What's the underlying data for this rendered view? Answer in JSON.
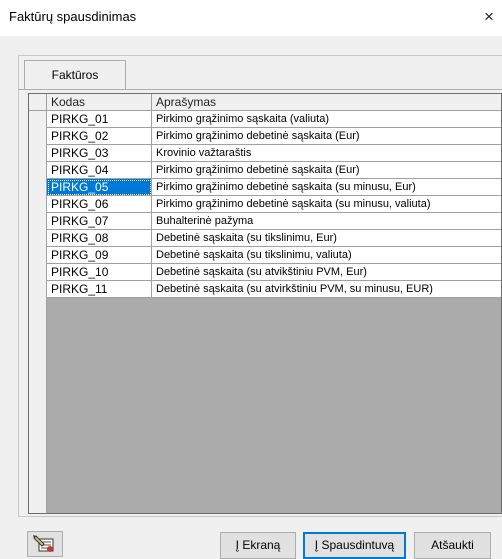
{
  "window": {
    "title": "Faktūrų spausdinimas",
    "close_label": "×"
  },
  "tabs": [
    {
      "label": "Faktūros"
    }
  ],
  "grid": {
    "columns": [
      "Kodas",
      "Aprašymas"
    ],
    "selected_index": 4,
    "rows": [
      {
        "code": "PIRKG_01",
        "description": "Pirkimo grąžinimo sąskaita (valiuta)"
      },
      {
        "code": "PIRKG_02",
        "description": "Pirkimo grąžinimo debetinė sąskaita (Eur)"
      },
      {
        "code": "PIRKG_03",
        "description": "Krovinio važtaraštis"
      },
      {
        "code": "PIRKG_04",
        "description": "Pirkimo grąžinimo debetinė sąskaita (Eur)"
      },
      {
        "code": "PIRKG_05",
        "description": "Pirkimo grąžinimo debetinė sąskaita (su minusu, Eur)"
      },
      {
        "code": "PIRKG_06",
        "description": "Pirkimo grąžinimo debetinė sąskaita (su minusu, valiuta)"
      },
      {
        "code": "PIRKG_07",
        "description": "Buhalterinė pažyma"
      },
      {
        "code": "PIRKG_08",
        "description": "Debetinė sąskaita (su tikslinimu, Eur)"
      },
      {
        "code": "PIRKG_09",
        "description": "Debetinė sąskaita (su tikslinimu, valiuta)"
      },
      {
        "code": "PIRKG_10",
        "description": "Debetinė sąskaita (su atvikštiniu PVM, Eur)"
      },
      {
        "code": "PIRKG_11",
        "description": "Debetinė sąskaita (su atvirkštiniu PVM, su minusu, EUR)"
      }
    ]
  },
  "footer": {
    "icon": "edit-form-icon",
    "screen_prefix": "Į",
    "screen_rest": " Ekraną",
    "printer_prefix": "Į",
    "printer_rest": " Spausdintuvą",
    "cancel_label": "Atšaukti"
  },
  "colors": {
    "selection": "#0078d7",
    "focus_border": "#0078d7"
  }
}
